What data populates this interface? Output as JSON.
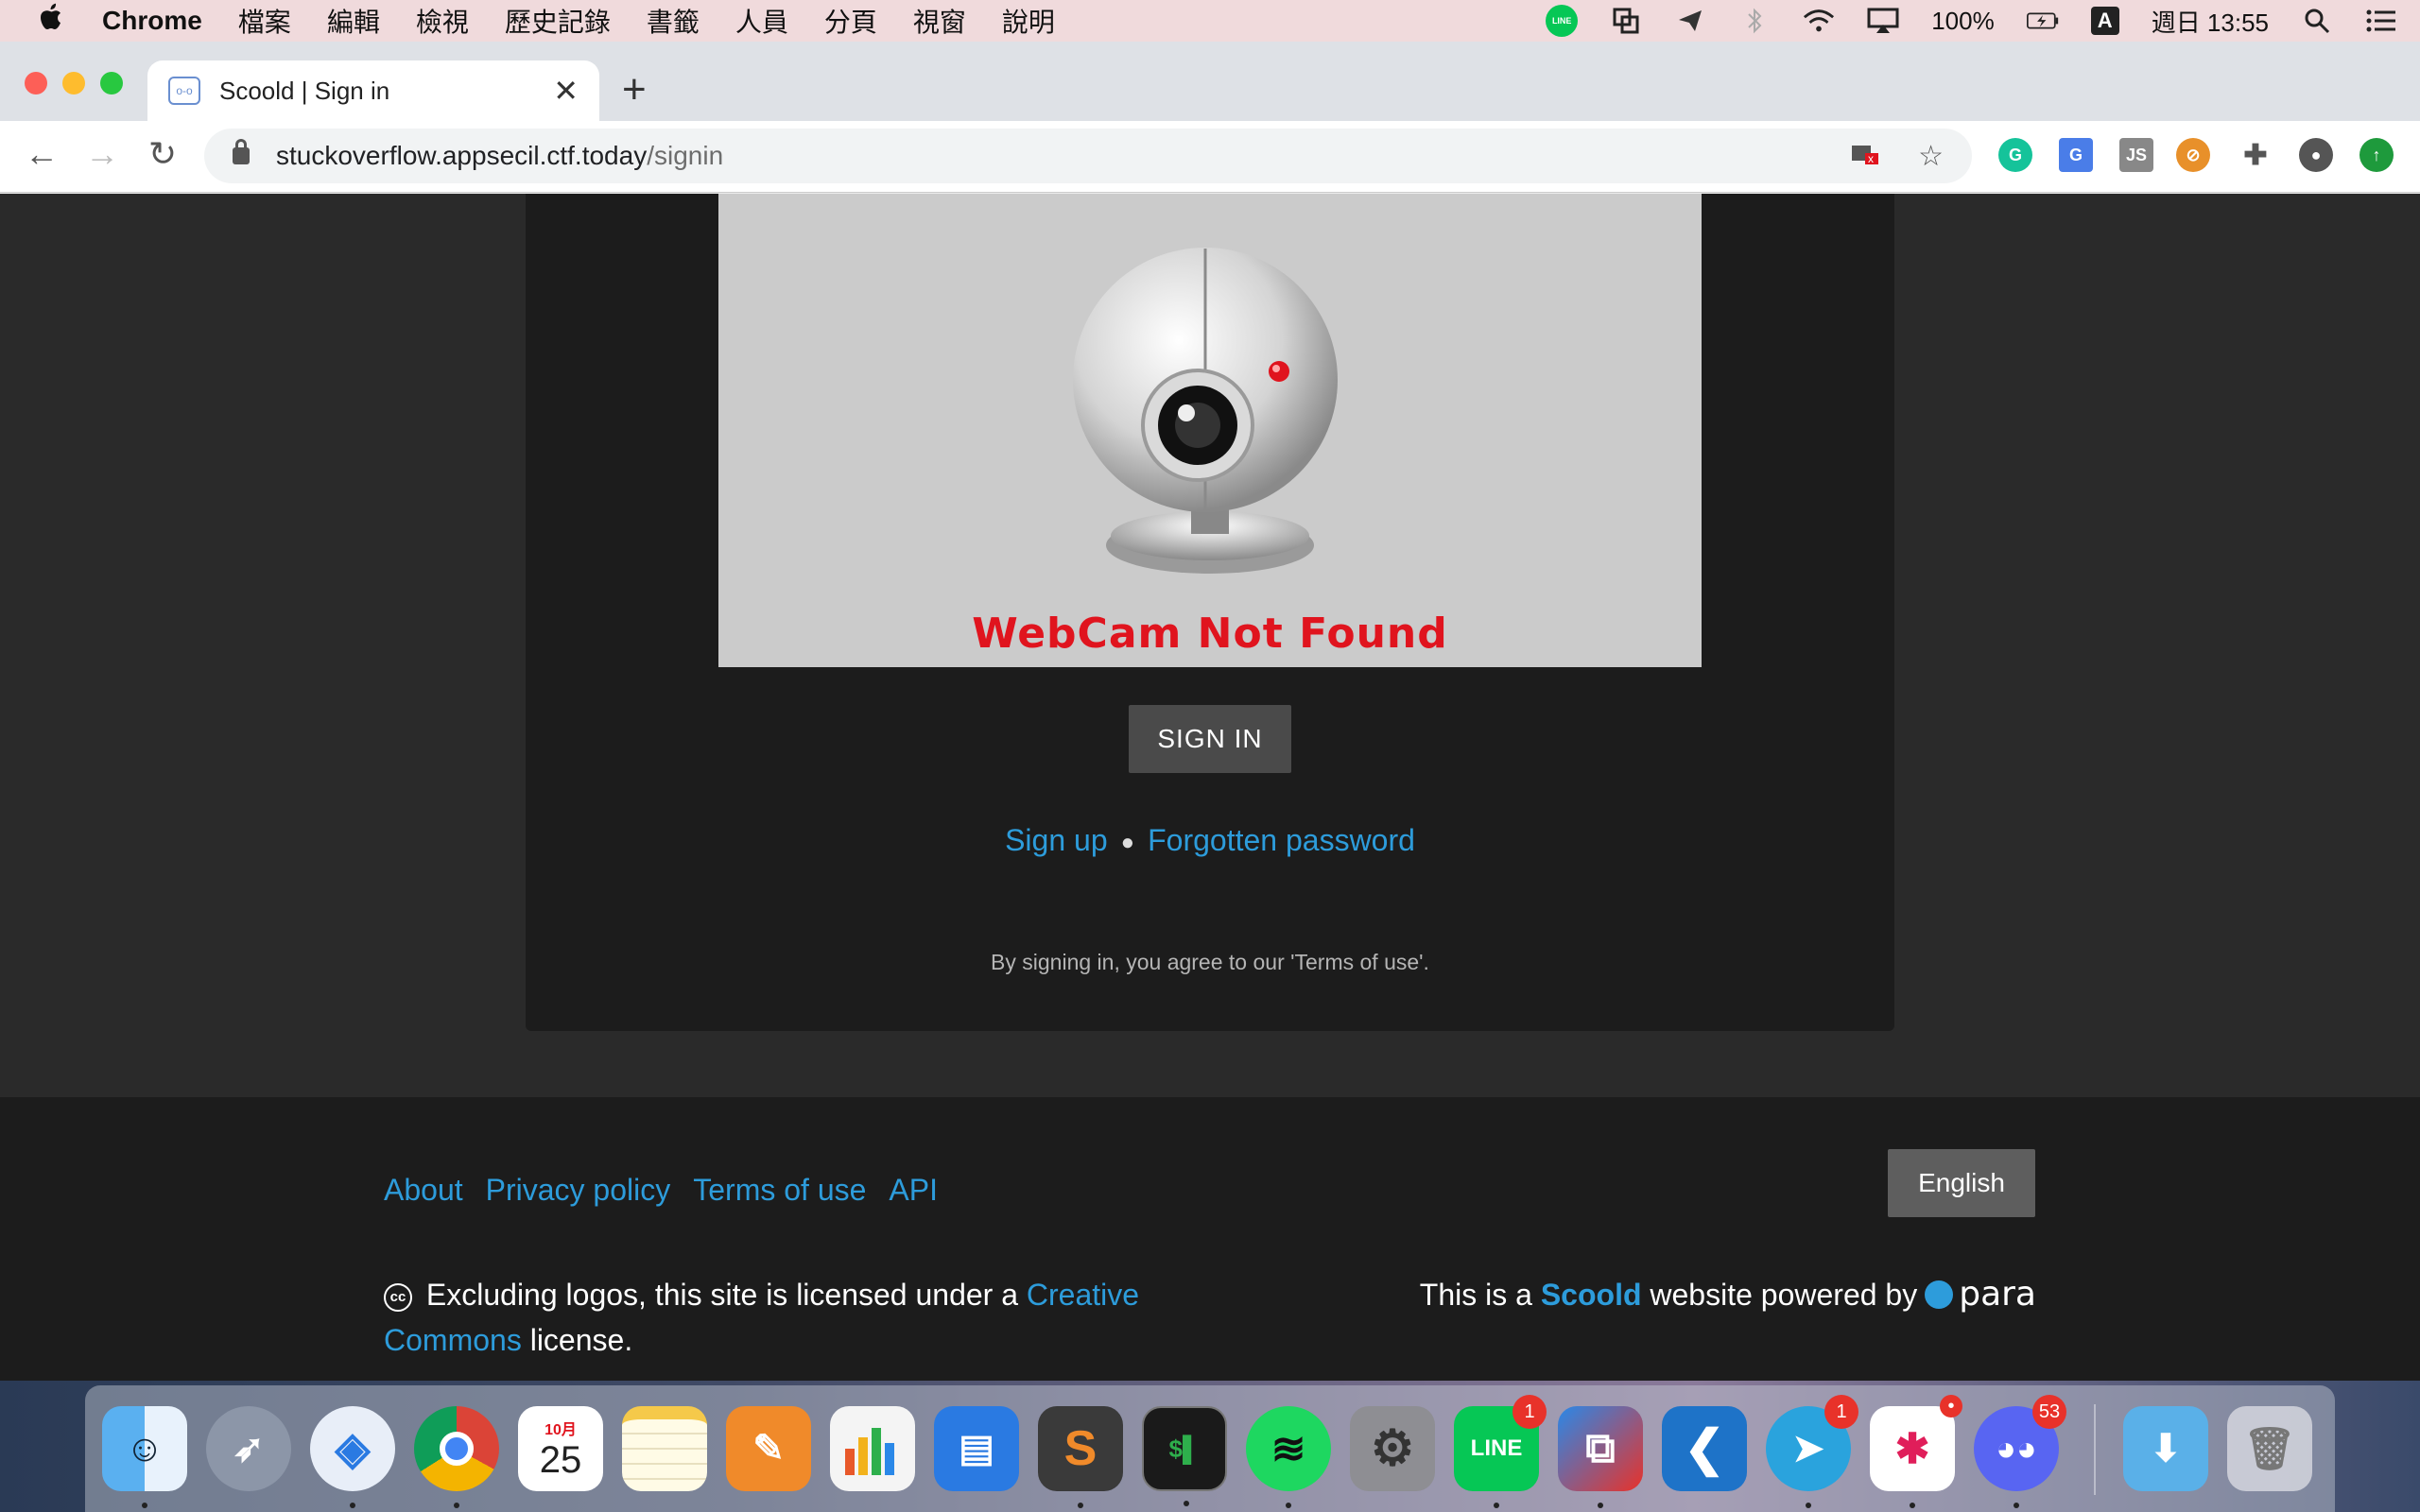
{
  "menubar": {
    "app_name": "Chrome",
    "items": [
      "檔案",
      "編輯",
      "檢視",
      "歷史記錄",
      "書籤",
      "人員",
      "分頁",
      "視窗",
      "說明"
    ],
    "battery": "100%",
    "input_method": "A",
    "clock": "週日 13:55"
  },
  "tab": {
    "title": "Scoold | Sign in"
  },
  "address_bar": {
    "host": "stuckoverflow.appsecil.ctf.today",
    "path": "/signin"
  },
  "page": {
    "webcam_caption": "WebCam Not Found",
    "sign_in_label": "SIGN IN",
    "sign_up_link": "Sign up",
    "forgot_link": "Forgotten password",
    "terms_note": "By signing in, you agree to our 'Terms of use'."
  },
  "footer": {
    "links": [
      "About",
      "Privacy policy",
      "Terms of use",
      "API"
    ],
    "language": "English",
    "license_prefix": "Excluding logos, this site is licensed under a",
    "license_link": "Creative Commons",
    "license_suffix": "license.",
    "powered_prefix": "This is a",
    "powered_brand": "Scoold",
    "powered_mid": "website powered by",
    "powered_logo": "para"
  },
  "dock": {
    "calendar_month": "10月",
    "calendar_day": "25",
    "line_badge": "1",
    "telegram_badge": "1",
    "discord_badge": "53"
  },
  "colors": {
    "link": "#2d9cdb",
    "page_bg": "#2a2a2a",
    "card_bg": "#1c1c1c",
    "error_red": "#e0141e"
  }
}
